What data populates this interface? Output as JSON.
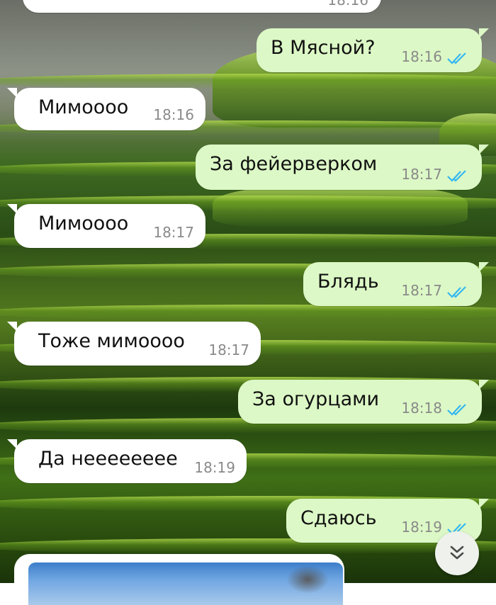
{
  "chat": {
    "partial_top_time": "18:16",
    "messages": [
      {
        "dir": "out",
        "text": "В Мясной?",
        "time": "18:16"
      },
      {
        "dir": "in",
        "text": "Мимоооо",
        "time": "18:16"
      },
      {
        "dir": "out",
        "text": "За фейерверком",
        "time": "18:17"
      },
      {
        "dir": "in",
        "text": "Мимоооо",
        "time": "18:17"
      },
      {
        "dir": "out",
        "text": "Блядь",
        "time": "18:17"
      },
      {
        "dir": "in",
        "text": "Тоже мимоооо",
        "time": "18:17"
      },
      {
        "dir": "out",
        "text": "За огурцами",
        "time": "18:18"
      },
      {
        "dir": "in",
        "text": "Да нееееееее",
        "time": "18:19"
      },
      {
        "dir": "out",
        "text": "Сдаюсь",
        "time": "18:19"
      }
    ],
    "scroll_button_icon": "double-chevron-down-icon",
    "read_tick_icon": "double-check-icon",
    "colors": {
      "incoming_bubble": "#ffffff",
      "outgoing_bubble": "#dcf8c6",
      "read_tick": "#34b7f1",
      "time_text": "#8a8a8a"
    }
  }
}
